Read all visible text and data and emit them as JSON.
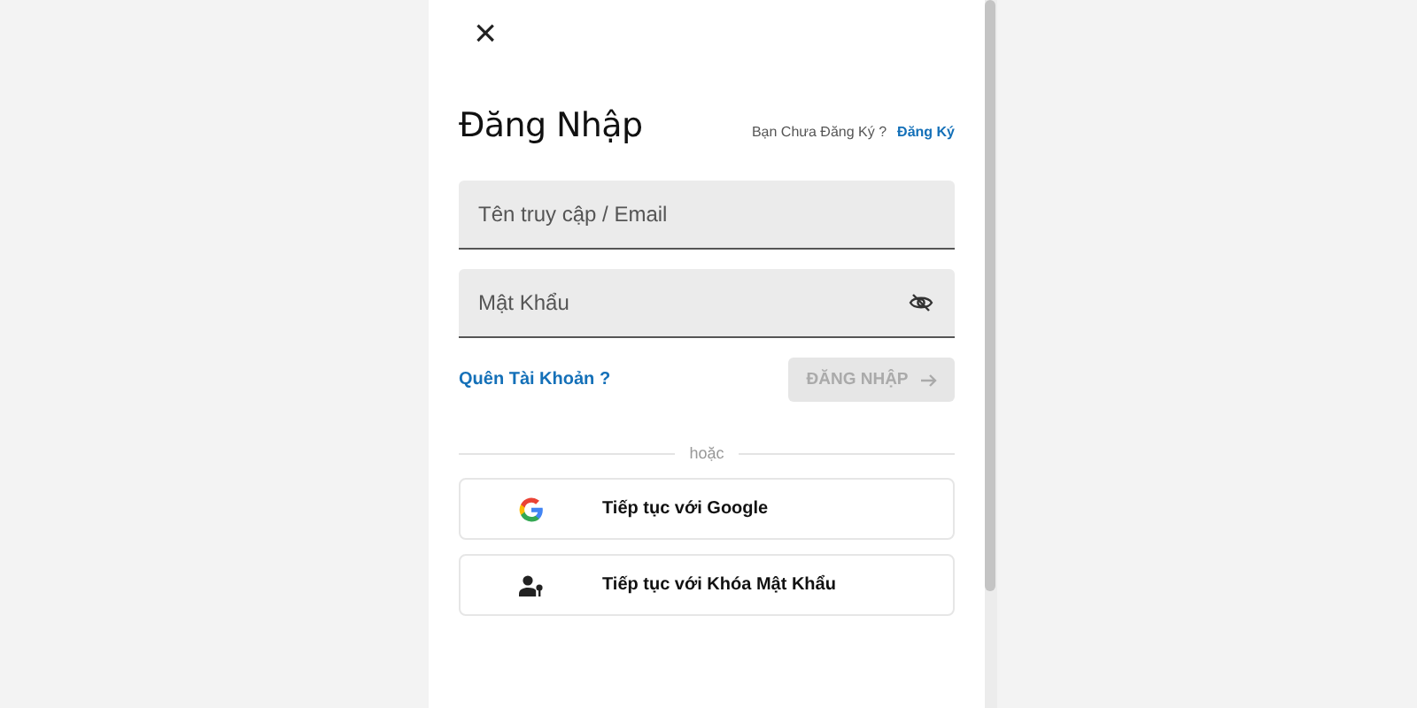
{
  "dialog": {
    "close": "×",
    "title": "Đăng Nhập",
    "signup_prompt": "Bạn Chưa Đăng Ký ?",
    "signup_link": "Đăng Ký"
  },
  "fields": [
    {
      "kind": "text",
      "placeholder": "Tên truy cập / Email"
    },
    {
      "kind": "password",
      "placeholder": "Mật Khẩu"
    }
  ],
  "forgot_link": "Quên Tài Khoản ?",
  "submit": {
    "label": "ĐĂNG NHẬP",
    "disabled": true
  },
  "separator": "hoặc",
  "social_buttons": [
    {
      "kind": "google",
      "label": "Tiếp tục với Google"
    },
    {
      "kind": "passkey",
      "label": "Tiếp tục với Khóa Mật Khẩu"
    }
  ]
}
